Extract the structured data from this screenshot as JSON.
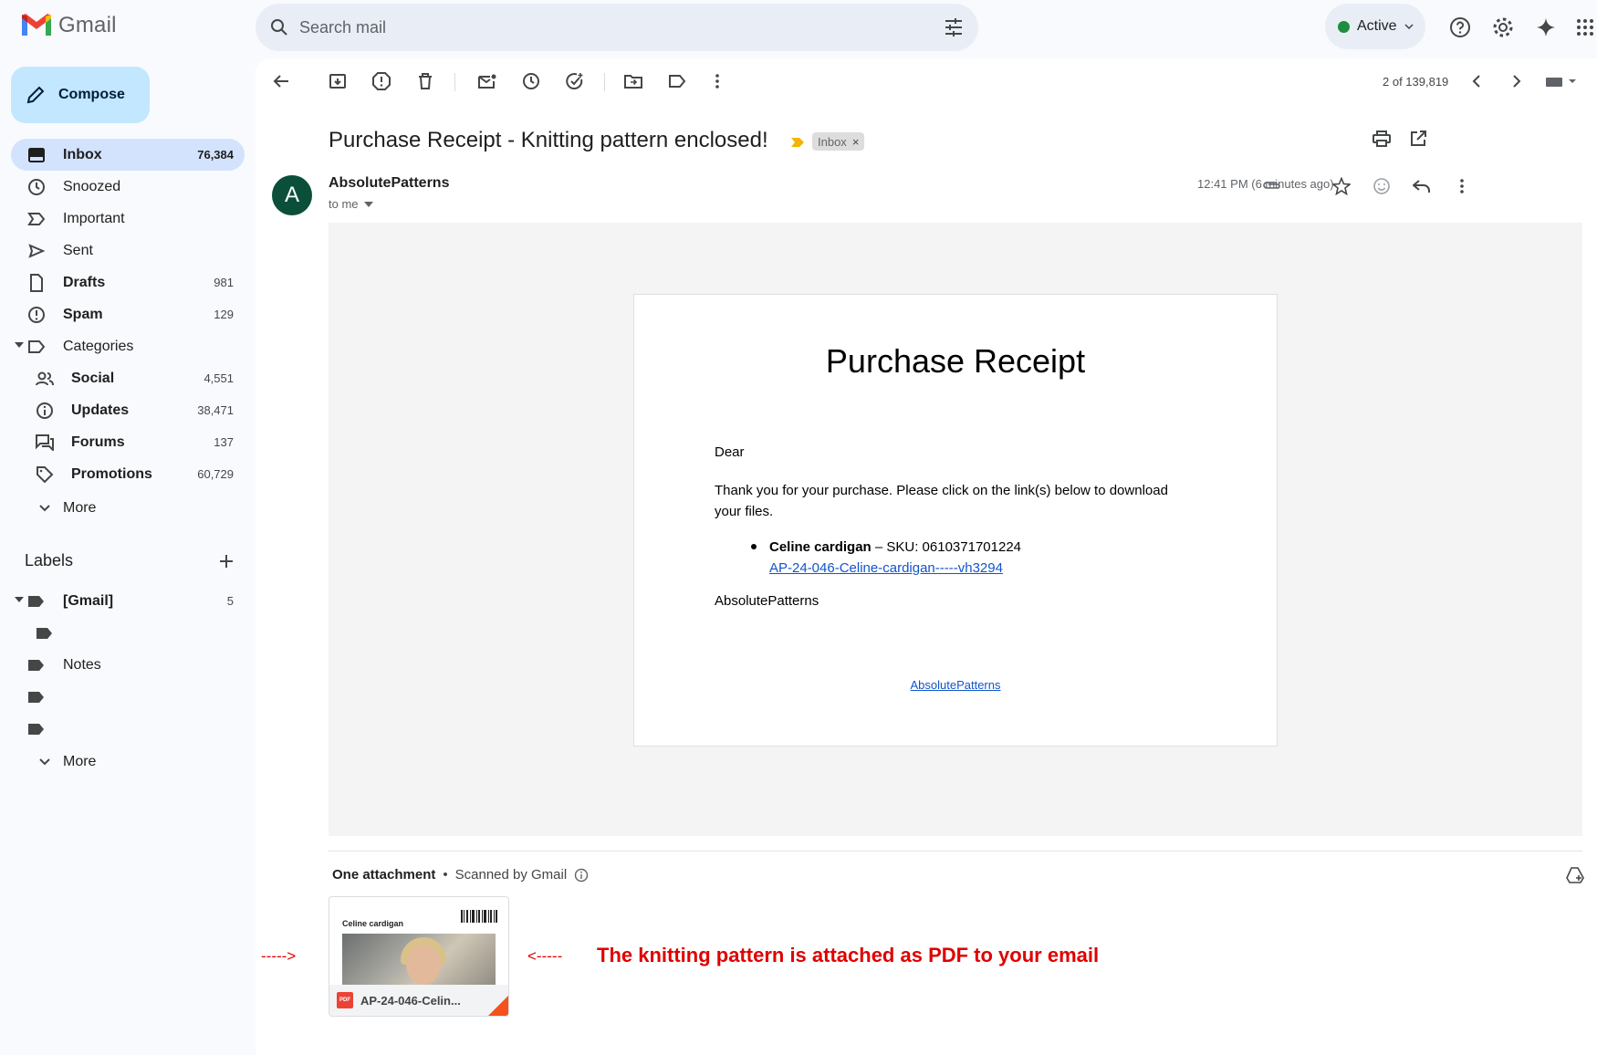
{
  "app": {
    "name": "Gmail"
  },
  "search": {
    "placeholder": "Search mail"
  },
  "status": {
    "label": "Active",
    "color": "#1e8e3e"
  },
  "compose": {
    "label": "Compose"
  },
  "nav": {
    "inbox": {
      "label": "Inbox",
      "count": "76,384"
    },
    "snoozed": {
      "label": "Snoozed"
    },
    "important": {
      "label": "Important"
    },
    "sent": {
      "label": "Sent"
    },
    "drafts": {
      "label": "Drafts",
      "count": "981"
    },
    "spam": {
      "label": "Spam",
      "count": "129"
    },
    "categories": {
      "label": "Categories"
    },
    "social": {
      "label": "Social",
      "count": "4,551"
    },
    "updates": {
      "label": "Updates",
      "count": "38,471"
    },
    "forums": {
      "label": "Forums",
      "count": "137"
    },
    "promotions": {
      "label": "Promotions",
      "count": "60,729"
    },
    "more": {
      "label": "More"
    }
  },
  "labels": {
    "heading": "Labels",
    "gmail": {
      "label": "[Gmail]",
      "count": "5"
    },
    "notes": {
      "label": "Notes"
    },
    "more": {
      "label": "More"
    }
  },
  "toolbar": {
    "pager": "2 of 139,819"
  },
  "message": {
    "subject": "Purchase Receipt - Knitting pattern enclosed!",
    "label_chip": "Inbox",
    "chip_close": "×",
    "avatar_letter": "A",
    "sender": "AbsolutePatterns",
    "to": "to me",
    "time": "12:41 PM (6 minutes ago)"
  },
  "receipt": {
    "title": "Purchase Receipt",
    "greeting": "Dear",
    "body": "Thank you for your purchase. Please click on the link(s) below to download your files.",
    "item_name": "Celine cardigan",
    "item_sku": " – SKU: 0610371701224",
    "item_link": "AP-24-046-Celine-cardigan-----vh3294",
    "signature": "AbsolutePatterns",
    "footer_link": "AbsolutePatterns"
  },
  "attachments": {
    "heading": "One attachment",
    "separator": "•",
    "scanned": "Scanned by Gmail",
    "file_name": "AP-24-046-Celin...",
    "file_type": "PDF",
    "thumb_title": "Celine cardigan"
  },
  "annotation": {
    "arrow_left": "----->",
    "arrow_right": "<-----",
    "text": "The knitting pattern is attached as PDF to your email",
    "color": "#e00000"
  }
}
